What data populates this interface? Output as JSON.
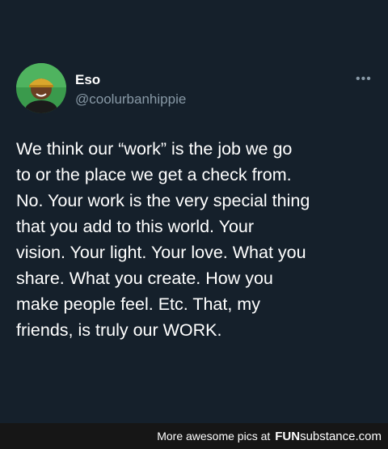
{
  "tweet": {
    "display_name": "Eso",
    "handle": "@coolurbanhippie",
    "more_icon": "•••",
    "text": "We think our “work” is the job we go\nto or the place we get a check from.\nNo. Your work is the very special thing\nthat you add to this world. Your\nvision. Your light. Your love. What you\nshare. What you create. How you\nmake people feel. Etc. That, my\nfriends, is truly our WORK."
  },
  "footer": {
    "tagline": "More awesome pics at",
    "brand_fun": "FUN",
    "brand_substance": "substance",
    "brand_tld": ".com"
  },
  "colors": {
    "background": "#15202b",
    "secondary_text": "#8899a6",
    "footer_bg": "#161616"
  }
}
